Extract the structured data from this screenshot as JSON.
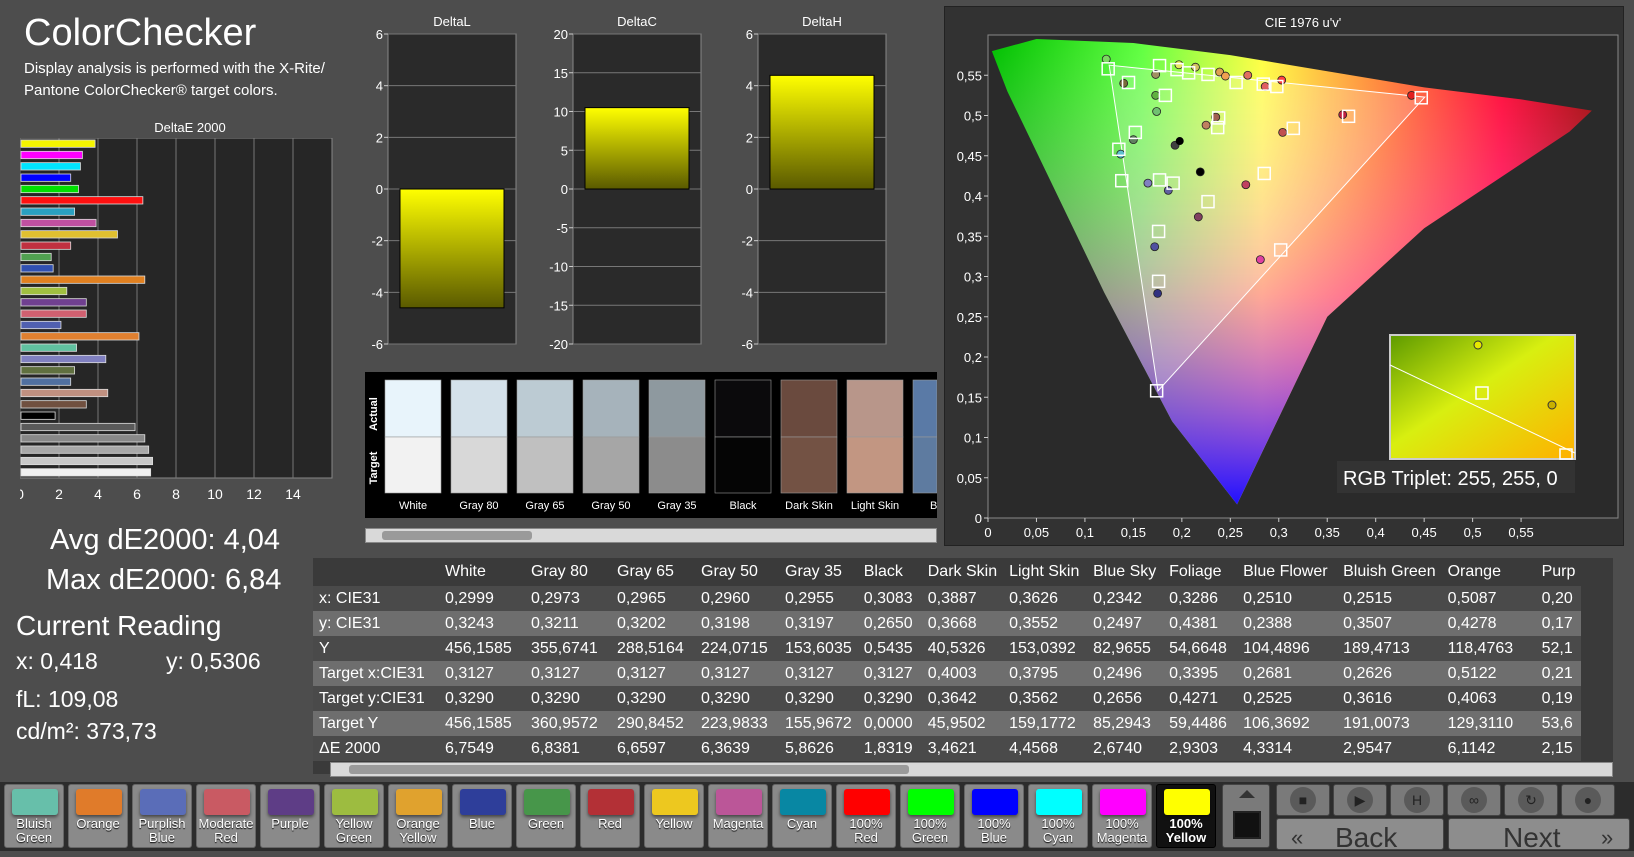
{
  "header": {
    "title": "ColorChecker",
    "subtitle": "Display analysis is performed with the X-Rite/ Pantone ColorChecker® target colors."
  },
  "deltaE_chart": {
    "title": "DeltaE 2000",
    "xticks": [
      "0",
      "2",
      "4",
      "6",
      "8",
      "10",
      "12",
      "14"
    ],
    "xmax": 16,
    "bars": [
      {
        "value": 3.85,
        "color": "#f5f500"
      },
      {
        "value": 3.2,
        "color": "#ff00ff"
      },
      {
        "value": 3.1,
        "color": "#00e5ff"
      },
      {
        "value": 2.6,
        "color": "#0000ff"
      },
      {
        "value": 3.0,
        "color": "#00e000"
      },
      {
        "value": 6.3,
        "color": "#ff1010"
      },
      {
        "value": 2.8,
        "color": "#2aa0c0"
      },
      {
        "value": 3.9,
        "color": "#c050a0"
      },
      {
        "value": 5.0,
        "color": "#e0c030"
      },
      {
        "value": 2.6,
        "color": "#c03040"
      },
      {
        "value": 1.6,
        "color": "#50a050"
      },
      {
        "value": 1.7,
        "color": "#3050b0"
      },
      {
        "value": 6.4,
        "color": "#e08020"
      },
      {
        "value": 2.4,
        "color": "#a0c040"
      },
      {
        "value": 3.4,
        "color": "#704090"
      },
      {
        "value": 3.4,
        "color": "#d06070"
      },
      {
        "value": 2.1,
        "color": "#5060b0"
      },
      {
        "value": 6.1,
        "color": "#e08030"
      },
      {
        "value": 2.9,
        "color": "#60c0a0"
      },
      {
        "value": 4.4,
        "color": "#8080c0"
      },
      {
        "value": 2.8,
        "color": "#607040"
      },
      {
        "value": 2.6,
        "color": "#5070a0"
      },
      {
        "value": 4.5,
        "color": "#c09080"
      },
      {
        "value": 3.4,
        "color": "#705040"
      },
      {
        "value": 1.8,
        "color": "#000000"
      },
      {
        "value": 5.9,
        "color": "#5a5a5a"
      },
      {
        "value": 6.4,
        "color": "#888888"
      },
      {
        "value": 6.6,
        "color": "#a8a8a8"
      },
      {
        "value": 6.8,
        "color": "#c8c8c8"
      },
      {
        "value": 6.7,
        "color": "#f0f0f0"
      }
    ]
  },
  "delta_charts": [
    {
      "title": "DeltaL",
      "ymin": -6,
      "ymax": 6,
      "ticks": [
        "6",
        "4",
        "2",
        "0",
        "-2",
        "-4",
        "-6"
      ],
      "value": -4.6
    },
    {
      "title": "DeltaC",
      "ymin": -20,
      "ymax": 20,
      "ticks": [
        "20",
        "15",
        "10",
        "5",
        "0",
        "-5",
        "-10",
        "-15",
        "-20"
      ],
      "value": 10.5
    },
    {
      "title": "DeltaH",
      "ymin": -6,
      "ymax": 6,
      "ticks": [
        "6",
        "4",
        "2",
        "0",
        "-2",
        "-4",
        "-6"
      ],
      "value": 4.4
    }
  ],
  "stats": {
    "avg": "Avg dE2000: 4,04",
    "max": "Max dE2000: 6,84",
    "current_title": "Current Reading",
    "x": "x: 0,418",
    "y": "y: 0,5306",
    "fl": "fL: 109,08",
    "cdm2": "cd/m²: 373,73"
  },
  "swatches": {
    "side_actual": "Actual",
    "side_target": "Target",
    "items": [
      {
        "label": "White",
        "actual": "#e8f4fb",
        "target": "#f2f2f2"
      },
      {
        "label": "Gray 80",
        "actual": "#d4e1ea",
        "target": "#d8d8d8"
      },
      {
        "label": "Gray 65",
        "actual": "#bccbd3",
        "target": "#c0c0c0"
      },
      {
        "label": "Gray 50",
        "actual": "#a6b3bb",
        "target": "#a6a6a6"
      },
      {
        "label": "Gray 35",
        "actual": "#8e999f",
        "target": "#8c8c8c"
      },
      {
        "label": "Black",
        "actual": "#0b0a0c",
        "target": "#050505"
      },
      {
        "label": "Dark Skin",
        "actual": "#6a4a3e",
        "target": "#735244"
      },
      {
        "label": "Light Skin",
        "actual": "#b8968a",
        "target": "#c29682"
      },
      {
        "label": "Blue",
        "actual": "#5a7aa6",
        "target": "#5e7ba0"
      }
    ]
  },
  "cie": {
    "title": "CIE 1976 u'v'",
    "xticks": [
      "0",
      "0,05",
      "0,1",
      "0,15",
      "0,2",
      "0,25",
      "0,3",
      "0,35",
      "0,4",
      "0,45",
      "0,5",
      "0,55"
    ],
    "yticks": [
      "0",
      "0,05",
      "0,1",
      "0,15",
      "0,2",
      "0,25",
      "0,3",
      "0,35",
      "0,4",
      "0,45",
      "0,5",
      "0,55"
    ],
    "triplet": "RGB Triplet: 255, 255, 0",
    "targets": [
      [
        0.124,
        0.558
      ],
      [
        0.145,
        0.541
      ],
      [
        0.183,
        0.525
      ],
      [
        0.177,
        0.562
      ],
      [
        0.195,
        0.557
      ],
      [
        0.207,
        0.553
      ],
      [
        0.227,
        0.551
      ],
      [
        0.256,
        0.541
      ],
      [
        0.284,
        0.539
      ],
      [
        0.298,
        0.536
      ],
      [
        0.238,
        0.497
      ],
      [
        0.237,
        0.485
      ],
      [
        0.315,
        0.484
      ],
      [
        0.372,
        0.499
      ],
      [
        0.447,
        0.522
      ],
      [
        0.152,
        0.479
      ],
      [
        0.135,
        0.458
      ],
      [
        0.177,
        0.42
      ],
      [
        0.191,
        0.416
      ],
      [
        0.227,
        0.393
      ],
      [
        0.285,
        0.428
      ],
      [
        0.302,
        0.333
      ],
      [
        0.176,
        0.356
      ],
      [
        0.176,
        0.294
      ],
      [
        0.174,
        0.158
      ],
      [
        0.138,
        0.419
      ]
    ],
    "actual": [
      [
        0.122,
        0.57
      ],
      [
        0.14,
        0.54
      ],
      [
        0.173,
        0.525
      ],
      [
        0.173,
        0.551
      ],
      [
        0.197,
        0.563
      ],
      [
        0.214,
        0.56
      ],
      [
        0.239,
        0.554
      ],
      [
        0.245,
        0.549
      ],
      [
        0.268,
        0.55
      ],
      [
        0.286,
        0.536
      ],
      [
        0.303,
        0.544
      ],
      [
        0.225,
        0.488
      ],
      [
        0.235,
        0.498
      ],
      [
        0.304,
        0.479
      ],
      [
        0.366,
        0.501
      ],
      [
        0.437,
        0.525
      ],
      [
        0.174,
        0.505
      ],
      [
        0.15,
        0.47
      ],
      [
        0.137,
        0.452
      ],
      [
        0.165,
        0.416
      ],
      [
        0.186,
        0.407
      ],
      [
        0.266,
        0.414
      ],
      [
        0.217,
        0.374
      ],
      [
        0.172,
        0.337
      ],
      [
        0.175,
        0.279
      ],
      [
        0.281,
        0.321
      ],
      [
        0.193,
        0.463
      ],
      [
        0.219,
        0.43
      ]
    ],
    "actual_colors": [
      "#7bd860",
      "#7a6a3a",
      "#60b040",
      "#a09060",
      "#e8e860",
      "#d0c060",
      "#e0a050",
      "#f0a050",
      "#e07060",
      "#e06060",
      "#ff4040",
      "#c08060",
      "#a06050",
      "#c05050",
      "#c02040",
      "#e02020",
      "#70c070",
      "#608060",
      "#60c0d0",
      "#8080c0",
      "#6060a0",
      "#c04060",
      "#804060",
      "#5050a0",
      "#303080",
      "#e040a0",
      "#404040",
      "#000000"
    ],
    "inset_points": [
      [
        0.44,
        0.51
      ],
      [
        0.42,
        0.52
      ],
      [
        0.45,
        0.53
      ]
    ]
  },
  "table": {
    "columns": [
      "",
      "White",
      "Gray 80",
      "Gray 65",
      "Gray 50",
      "Gray 35",
      "Black",
      "Dark Skin",
      "Light Skin",
      "Blue Sky",
      "Foliage",
      "Blue Flower",
      "Bluish Green",
      "Orange",
      "Purp"
    ],
    "rows": [
      [
        "x: CIE31",
        "0,2999",
        "0,2973",
        "0,2965",
        "0,2960",
        "0,2955",
        "0,3083",
        "0,3887",
        "0,3626",
        "0,2342",
        "0,3286",
        "0,2510",
        "0,2515",
        "0,5087",
        "0,20"
      ],
      [
        "y: CIE31",
        "0,3243",
        "0,3211",
        "0,3202",
        "0,3198",
        "0,3197",
        "0,2650",
        "0,3668",
        "0,3552",
        "0,2497",
        "0,4381",
        "0,2388",
        "0,3507",
        "0,4278",
        "0,17"
      ],
      [
        "Y",
        "456,1585",
        "355,6741",
        "288,5164",
        "224,0715",
        "153,6035",
        "0,5435",
        "40,5326",
        "153,0392",
        "82,9655",
        "54,6648",
        "104,4896",
        "189,4713",
        "118,4763",
        "52,1"
      ],
      [
        "Target x:CIE31",
        "0,3127",
        "0,3127",
        "0,3127",
        "0,3127",
        "0,3127",
        "0,3127",
        "0,4003",
        "0,3795",
        "0,2496",
        "0,3395",
        "0,2681",
        "0,2626",
        "0,5122",
        "0,21"
      ],
      [
        "Target y:CIE31",
        "0,3290",
        "0,3290",
        "0,3290",
        "0,3290",
        "0,3290",
        "0,3290",
        "0,3642",
        "0,3562",
        "0,2656",
        "0,4271",
        "0,2525",
        "0,3616",
        "0,4063",
        "0,19"
      ],
      [
        "Target Y",
        "456,1585",
        "360,9572",
        "290,8452",
        "223,9833",
        "155,9672",
        "0,0000",
        "45,9502",
        "159,1772",
        "85,2943",
        "59,4486",
        "106,3692",
        "191,0073",
        "129,3110",
        "53,6"
      ],
      [
        "ΔE 2000",
        "6,7549",
        "6,8381",
        "6,6597",
        "6,3639",
        "5,8626",
        "1,8319",
        "3,4621",
        "4,4568",
        "2,6740",
        "2,9303",
        "4,3314",
        "2,9547",
        "6,1142",
        "2,15"
      ]
    ]
  },
  "patches": [
    {
      "label": "Bluish Green",
      "color": "#67bfaa"
    },
    {
      "label": "Orange",
      "color": "#e07b2a"
    },
    {
      "label": "Purplish Blue",
      "color": "#5a6db8"
    },
    {
      "label": "Moderate Red",
      "color": "#c95a63"
    },
    {
      "label": "Purple",
      "color": "#5e3d86"
    },
    {
      "label": "Yellow Green",
      "color": "#9dbc40"
    },
    {
      "label": "Orange Yellow",
      "color": "#e0a22e"
    },
    {
      "label": "Blue",
      "color": "#2e3e9a"
    },
    {
      "label": "Green",
      "color": "#47964a"
    },
    {
      "label": "Red",
      "color": "#b33036"
    },
    {
      "label": "Yellow",
      "color": "#edc81f"
    },
    {
      "label": "Magenta",
      "color": "#bb5698"
    },
    {
      "label": "Cyan",
      "color": "#0887a3"
    },
    {
      "label": "100% Red",
      "color": "#ff0000"
    },
    {
      "label": "100% Green",
      "color": "#00ff00"
    },
    {
      "label": "100% Blue",
      "color": "#0000ff"
    },
    {
      "label": "100% Cyan",
      "color": "#00ffff"
    },
    {
      "label": "100% Magenta",
      "color": "#ff00ff"
    },
    {
      "label": "100% Yellow",
      "color": "#ffff00",
      "active": true
    }
  ],
  "nav": {
    "back": "Back",
    "next": "Next"
  }
}
